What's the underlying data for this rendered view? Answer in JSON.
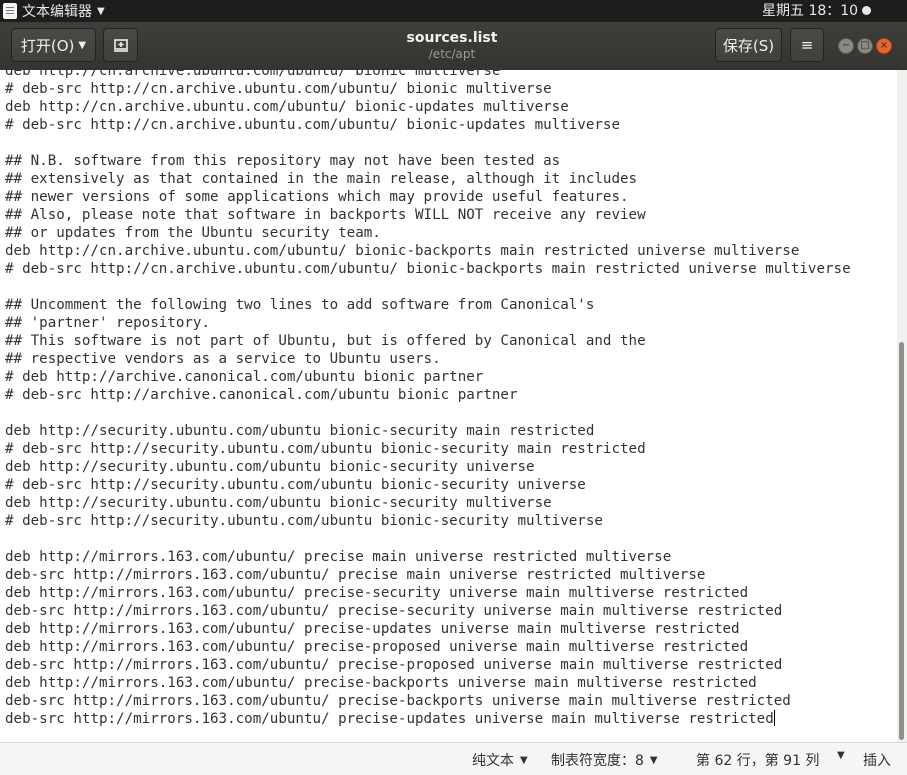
{
  "top_panel": {
    "app_name": "文本编辑器",
    "app_caret": "▼",
    "clock": "星期五 18：10"
  },
  "header": {
    "open_label": "打开(O)",
    "dropdown_glyph": "▼",
    "title": "sources.list",
    "subtitle": "/etc/apt",
    "save_label": "保存(S)",
    "menu_glyph": "≡",
    "min_glyph": "−",
    "max_glyph": "□",
    "close_glyph": "×"
  },
  "editor": {
    "lines": [
      "deb http://cn.archive.ubuntu.com/ubuntu/ bionic multiverse",
      "# deb-src http://cn.archive.ubuntu.com/ubuntu/ bionic multiverse",
      "deb http://cn.archive.ubuntu.com/ubuntu/ bionic-updates multiverse",
      "# deb-src http://cn.archive.ubuntu.com/ubuntu/ bionic-updates multiverse",
      "",
      "## N.B. software from this repository may not have been tested as",
      "## extensively as that contained in the main release, although it includes",
      "## newer versions of some applications which may provide useful features.",
      "## Also, please note that software in backports WILL NOT receive any review",
      "## or updates from the Ubuntu security team.",
      "deb http://cn.archive.ubuntu.com/ubuntu/ bionic-backports main restricted universe multiverse",
      "# deb-src http://cn.archive.ubuntu.com/ubuntu/ bionic-backports main restricted universe multiverse",
      "",
      "## Uncomment the following two lines to add software from Canonical's",
      "## 'partner' repository.",
      "## This software is not part of Ubuntu, but is offered by Canonical and the",
      "## respective vendors as a service to Ubuntu users.",
      "# deb http://archive.canonical.com/ubuntu bionic partner",
      "# deb-src http://archive.canonical.com/ubuntu bionic partner",
      "",
      "deb http://security.ubuntu.com/ubuntu bionic-security main restricted",
      "# deb-src http://security.ubuntu.com/ubuntu bionic-security main restricted",
      "deb http://security.ubuntu.com/ubuntu bionic-security universe",
      "# deb-src http://security.ubuntu.com/ubuntu bionic-security universe",
      "deb http://security.ubuntu.com/ubuntu bionic-security multiverse",
      "# deb-src http://security.ubuntu.com/ubuntu bionic-security multiverse",
      "",
      "deb http://mirrors.163.com/ubuntu/ precise main universe restricted multiverse",
      "deb-src http://mirrors.163.com/ubuntu/ precise main universe restricted multiverse",
      "deb http://mirrors.163.com/ubuntu/ precise-security universe main multiverse restricted",
      "deb-src http://mirrors.163.com/ubuntu/ precise-security universe main multiverse restricted",
      "deb http://mirrors.163.com/ubuntu/ precise-updates universe main multiverse restricted",
      "deb http://mirrors.163.com/ubuntu/ precise-proposed universe main multiverse restricted",
      "deb-src http://mirrors.163.com/ubuntu/ precise-proposed universe main multiverse restricted",
      "deb http://mirrors.163.com/ubuntu/ precise-backports universe main multiverse restricted",
      "deb-src http://mirrors.163.com/ubuntu/ precise-backports universe main multiverse restricted",
      "deb-src http://mirrors.163.com/ubuntu/ precise-updates universe main multiverse restricted"
    ]
  },
  "status": {
    "language": "纯文本",
    "tab_width": "制表符宽度：8",
    "position": "第 62 行，第 91 列",
    "mode": "插入",
    "caret_glyph": "▼"
  }
}
